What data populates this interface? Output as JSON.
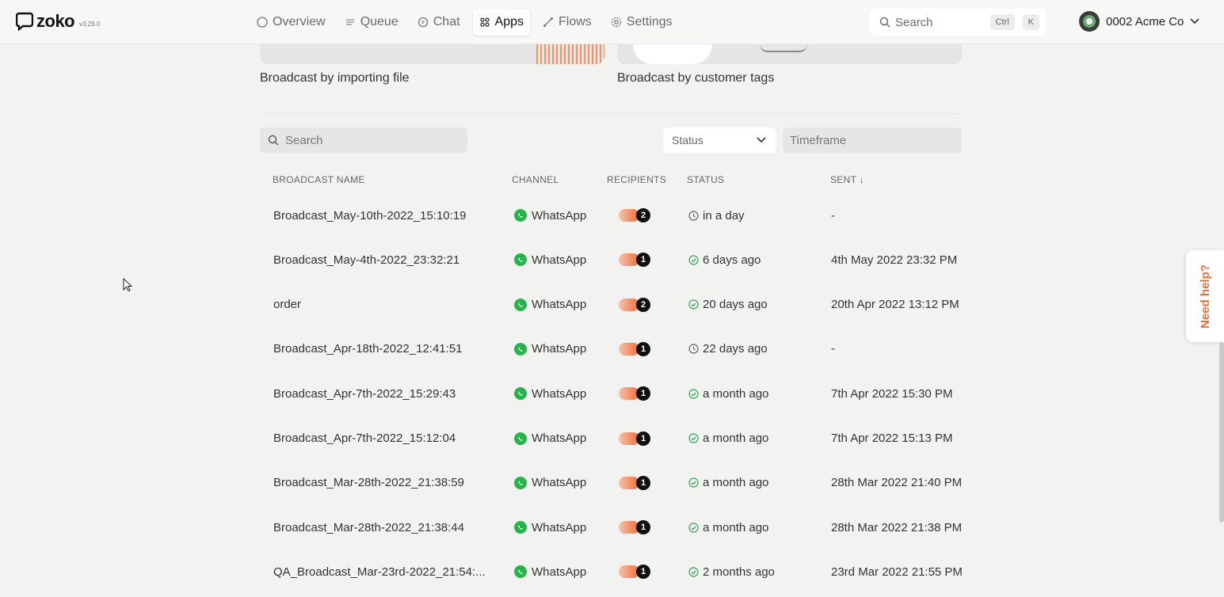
{
  "app": {
    "name": "zoko",
    "version": "v3.29.0"
  },
  "nav": [
    {
      "label": "Overview",
      "icon": "circle-icon",
      "active": false
    },
    {
      "label": "Queue",
      "icon": "queue-icon",
      "active": false
    },
    {
      "label": "Chat",
      "icon": "chat-icon",
      "active": false
    },
    {
      "label": "Apps",
      "icon": "grid-icon",
      "active": true
    },
    {
      "label": "Flows",
      "icon": "flow-icon",
      "active": false
    },
    {
      "label": "Settings",
      "icon": "gear-icon",
      "active": false
    }
  ],
  "top_search": {
    "placeholder": "Search",
    "shortcut_1": "Ctrl",
    "shortcut_2": "K"
  },
  "account": {
    "name": "0002 Acme Co"
  },
  "cards": [
    {
      "label": "Broadcast by importing file"
    },
    {
      "label": "Broadcast by customer tags"
    }
  ],
  "filters": {
    "search_placeholder": "Search",
    "status_label": "Status",
    "timeframe_placeholder": "Timeframe"
  },
  "table": {
    "headers": {
      "name": "BROADCAST NAME",
      "channel": "CHANNEL",
      "recipients": "RECIPIENTS",
      "status": "STATUS",
      "sent": "SENT ↓"
    },
    "rows": [
      {
        "name": "Broadcast_May-10th-2022_15:10:19",
        "channel": "WhatsApp",
        "recipients": "2",
        "status": "in a day",
        "status_icon": "clock-icon",
        "sent": "-"
      },
      {
        "name": "Broadcast_May-4th-2022_23:32:21",
        "channel": "WhatsApp",
        "recipients": "1",
        "status": "6 days ago",
        "status_icon": "check-circle-icon",
        "sent": "4th May 2022 23:32 PM"
      },
      {
        "name": "order",
        "channel": "WhatsApp",
        "recipients": "2",
        "status": "20 days ago",
        "status_icon": "check-circle-icon",
        "sent": "20th Apr 2022 13:12 PM"
      },
      {
        "name": "Broadcast_Apr-18th-2022_12:41:51",
        "channel": "WhatsApp",
        "recipients": "1",
        "status": "22 days ago",
        "status_icon": "clock-icon",
        "sent": "-"
      },
      {
        "name": "Broadcast_Apr-7th-2022_15:29:43",
        "channel": "WhatsApp",
        "recipients": "1",
        "status": "a month ago",
        "status_icon": "check-circle-icon",
        "sent": "7th Apr 2022 15:30 PM"
      },
      {
        "name": "Broadcast_Apr-7th-2022_15:12:04",
        "channel": "WhatsApp",
        "recipients": "1",
        "status": "a month ago",
        "status_icon": "check-circle-icon",
        "sent": "7th Apr 2022 15:13 PM"
      },
      {
        "name": "Broadcast_Mar-28th-2022_21:38:59",
        "channel": "WhatsApp",
        "recipients": "1",
        "status": "a month ago",
        "status_icon": "check-circle-icon",
        "sent": "28th Mar 2022 21:40 PM"
      },
      {
        "name": "Broadcast_Mar-28th-2022_21:38:44",
        "channel": "WhatsApp",
        "recipients": "1",
        "status": "a month ago",
        "status_icon": "check-circle-icon",
        "sent": "28th Mar 2022 21:38 PM"
      },
      {
        "name": "QA_Broadcast_Mar-23rd-2022_21:54:...",
        "channel": "WhatsApp",
        "recipients": "1",
        "status": "2 months ago",
        "status_icon": "check-circle-icon",
        "sent": "23rd Mar 2022 21:55 PM"
      }
    ]
  },
  "help": {
    "label": "Need help?"
  },
  "colors": {
    "accent": "#ef6b3b",
    "whatsapp": "#29b34c",
    "success": "#3aa35b",
    "background": "#f2f2f1"
  }
}
